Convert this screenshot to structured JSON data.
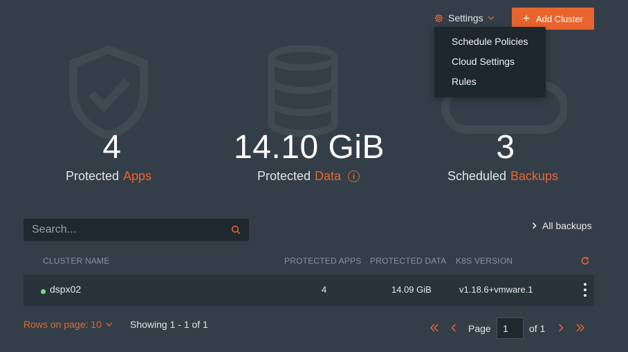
{
  "colors": {
    "accent": "#e9652f",
    "background": "#343e48",
    "status_ok": "#71dd79"
  },
  "toolbar": {
    "settings_label": "Settings",
    "add_cluster_label": "Add Cluster",
    "settings_icon": "gear-icon",
    "add_icon": "plus-icon"
  },
  "settings_menu": {
    "items": [
      {
        "label": "Schedule Policies"
      },
      {
        "label": "Cloud Settings"
      },
      {
        "label": "Rules"
      }
    ]
  },
  "stats": {
    "apps": {
      "value": "4",
      "label": "Protected",
      "accent": "Apps",
      "icon": "shield-check-icon"
    },
    "data": {
      "value": "14.10 GiB",
      "label": "Protected",
      "accent": "Data",
      "icon": "database-icon",
      "info": "i"
    },
    "backups": {
      "value": "3",
      "label": "Scheduled",
      "accent": "Backups",
      "icon": "cloud-icon"
    }
  },
  "search": {
    "placeholder": "Search..."
  },
  "all_backups": {
    "label": "All backups"
  },
  "table": {
    "headers": [
      "CLUSTER NAME",
      "PROTECTED APPS",
      "PROTECTED DATA",
      "K8S VERSION"
    ],
    "rows": [
      {
        "name": "dspx02",
        "apps": "4",
        "data": "14.09 GiB",
        "version": "v1.18.6+vmware.1",
        "status": "online"
      }
    ]
  },
  "footer": {
    "rows_per_page": "Rows on page: 10",
    "showing": "Showing 1 - 1 of 1",
    "page_label": "Page",
    "page_value": "1",
    "of_label": "of 1"
  }
}
